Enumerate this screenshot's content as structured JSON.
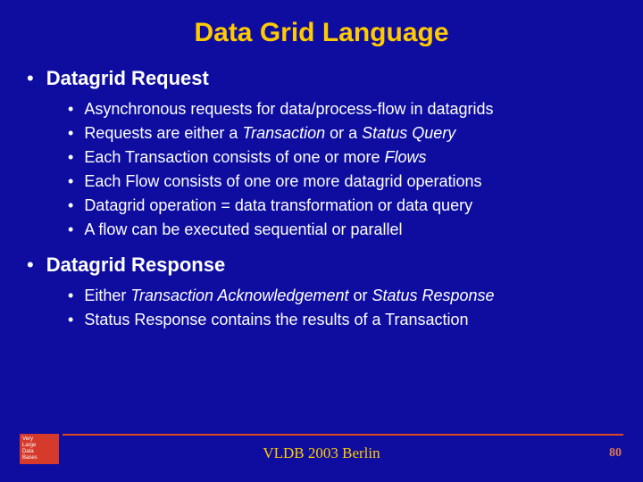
{
  "title": "Data Grid Language",
  "sections": [
    {
      "heading": "Datagrid Request",
      "items": [
        "Asynchronous requests for data/process-flow in datagrids",
        "Requests are either a <i>Transaction</i> or a <i>Status Query</i>",
        "Each Transaction consists of one or more <i>Flows</i>",
        "Each Flow consists of one ore more datagrid operations",
        "Datagrid operation = data transformation or data query",
        "A flow can be executed sequential or parallel"
      ]
    },
    {
      "heading": "Datagrid Response",
      "items": [
        "Either <i>Transaction Acknowledgement</i> or <i>Status Response</i>",
        "Status Response contains the results of a Transaction"
      ]
    }
  ],
  "logo": {
    "line1": "Very",
    "line2": "Large",
    "line3": "Data",
    "line4": "Bases"
  },
  "footer_text": "VLDB 2003 Berlin",
  "page_number": "80"
}
